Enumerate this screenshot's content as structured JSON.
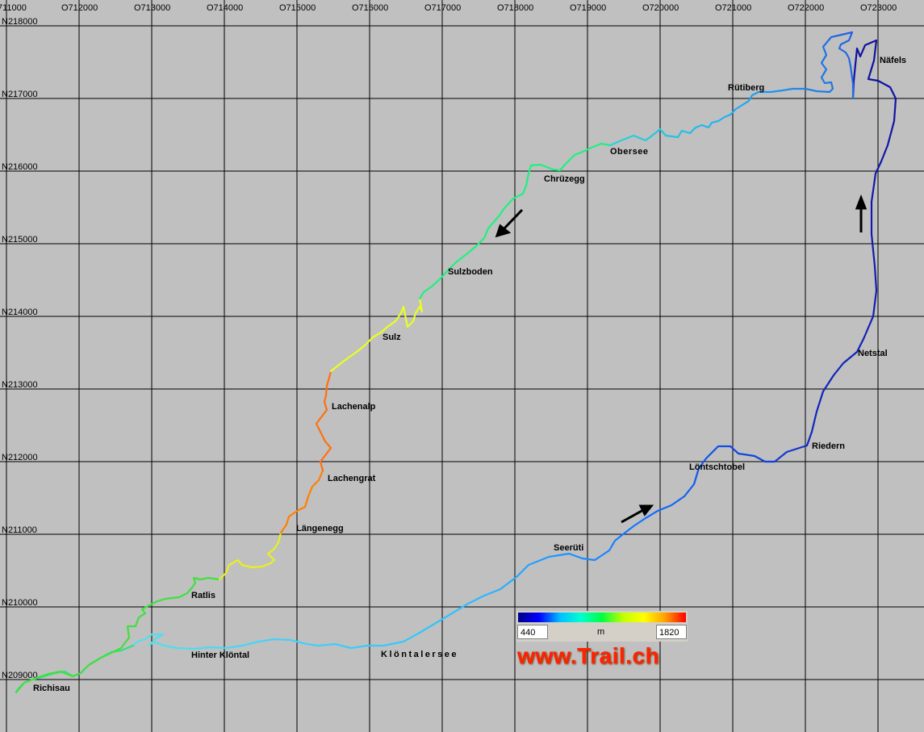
{
  "grid": {
    "easting_labels": [
      "711000",
      "O712000",
      "O713000",
      "O714000",
      "O715000",
      "O716000",
      "O717000",
      "O718000",
      "O719000",
      "O720000",
      "O721000",
      "O722000",
      "O723000"
    ],
    "northing_labels": [
      "N218000",
      "N217000",
      "N216000",
      "N215000",
      "N214000",
      "N213000",
      "N212000",
      "N211000",
      "N210000",
      "N209000"
    ]
  },
  "places": [
    {
      "id": "nafels",
      "name": "Näfels",
      "color": "#000000"
    },
    {
      "id": "rutiberg",
      "name": "Rütiberg",
      "color": "#000000"
    },
    {
      "id": "obersee",
      "name": "Obersee",
      "color": "#0000cc"
    },
    {
      "id": "chruzegg",
      "name": "Chrüzegg",
      "color": "#000000"
    },
    {
      "id": "sulzboden",
      "name": "Sulzboden",
      "color": "#000000"
    },
    {
      "id": "sulz",
      "name": "Sulz",
      "color": "#000000"
    },
    {
      "id": "netstal",
      "name": "Netstal",
      "color": "#000000"
    },
    {
      "id": "lachenalp",
      "name": "Lachenalp",
      "color": "#000000"
    },
    {
      "id": "riedern",
      "name": "Riedern",
      "color": "#000000"
    },
    {
      "id": "lontschtobel",
      "name": "Löntschtobel",
      "color": "#000000"
    },
    {
      "id": "lachengrat",
      "name": "Lachengrat",
      "color": "#dd0000"
    },
    {
      "id": "langenegg",
      "name": "Längenegg",
      "color": "#000000"
    },
    {
      "id": "seeruti",
      "name": "Seerüti",
      "color": "#000000"
    },
    {
      "id": "ratlis",
      "name": "Ratlis",
      "color": "#000000"
    },
    {
      "id": "hinter_klontal",
      "name": "Hinter Klöntal",
      "color": "#000000"
    },
    {
      "id": "klontalersee",
      "name": "Klöntalersee",
      "color": "#0000cc"
    },
    {
      "id": "richisau",
      "name": "Richisau",
      "color": "#000000"
    }
  ],
  "legend": {
    "min": "440",
    "unit": "m",
    "max": "1820",
    "colors": [
      "#00008a",
      "#0000ff",
      "#00c0ff",
      "#00ffd0",
      "#00ff40",
      "#c0ff00",
      "#ffff00",
      "#ffa000",
      "#ff0000"
    ]
  },
  "watermark": "www.Trail.ch"
}
